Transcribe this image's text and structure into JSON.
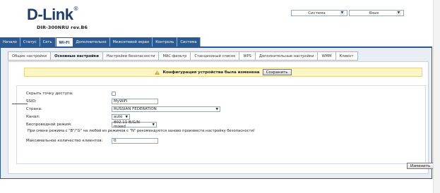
{
  "brand": {
    "logo": "D-Link",
    "model": "DIR-300NRU rev.B6"
  },
  "top_selects": {
    "system": "Система",
    "language": "Язык"
  },
  "main_tabs": [
    "Начало",
    "Статус",
    "Сеть",
    "Wi-Fi",
    "Дополнительно",
    "Межсетевой экран",
    "Контроль",
    "Система"
  ],
  "main_active": "Wi-Fi",
  "sub_tabs": [
    "Общие настройки",
    "Основные настройки",
    "Настройки безопасности",
    "MAC-фильтр",
    "Станционный список",
    "WPS",
    "Дополнительные настройки",
    "WMM",
    "Клиент"
  ],
  "sub_active": "Основные настройки",
  "notice": {
    "text": "Конфигурация устройства была изменена",
    "button": "Сохранить"
  },
  "form": {
    "hide_ap_label": "Скрыть точку доступа:",
    "hide_ap_checked": false,
    "ssid_label": "SSID:",
    "ssid_value": "MyWiFi",
    "country_label": "Страна:",
    "country_value": "RUSSIAN FEDERATION",
    "channel_label": "Канал:",
    "channel_value": "auto",
    "mode_label": "Беспроводной режим:",
    "mode_value": "802.11 B/G/N mixed",
    "mode_hint": "При смене режима с \"B\"/\"G\" на любой из режимов с \"N\" рекомендуется заново произвести настройку безопасности!",
    "max_clients_label": "Максимальное количество клиентов:",
    "max_clients_value": "0"
  },
  "change_button": "Изменить",
  "colors": {
    "brand_blue": "#2a5a93",
    "notice_bg": "#fdf5c4",
    "marker_red": "#d9231c"
  }
}
